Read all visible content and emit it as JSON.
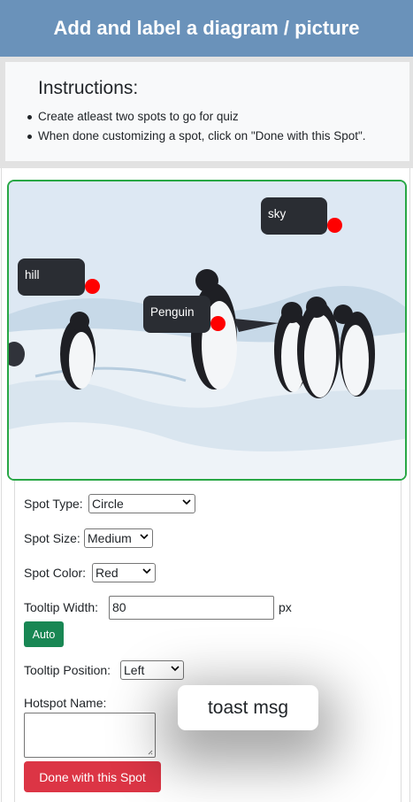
{
  "header": {
    "title": "Add and label a diagram / picture"
  },
  "instructions": {
    "title": "Instructions:",
    "items": [
      "Create atleast two spots to go for quiz",
      "When done customizing a spot, click on \"Done with this Spot\"."
    ]
  },
  "picture": {
    "hotspots": [
      {
        "label": "sky",
        "color": "#ff0000"
      },
      {
        "label": "hill",
        "color": "#ff0000"
      },
      {
        "label": "Penguin",
        "color": "#ff0000"
      }
    ],
    "border_color": "#28a745"
  },
  "form": {
    "spot_type_label": "Spot Type:",
    "spot_type_value": "Circle",
    "spot_size_label": "Spot Size:",
    "spot_size_value": "Medium",
    "spot_color_label": "Spot Color:",
    "spot_color_value": "Red",
    "tooltip_width_label": "Tooltip Width:",
    "tooltip_width_value": "80",
    "tooltip_width_unit": "px",
    "auto_button": "Auto",
    "tooltip_position_label": "Tooltip Position:",
    "tooltip_position_value": "Left",
    "hotspot_name_label": "Hotspot Name:",
    "hotspot_name_value": "",
    "done_button": "Done with this Spot"
  },
  "toast": {
    "message": "toast msg"
  },
  "colors": {
    "header_bg": "#6a92ba",
    "auto_button": "#198754",
    "done_button": "#dc3545"
  }
}
